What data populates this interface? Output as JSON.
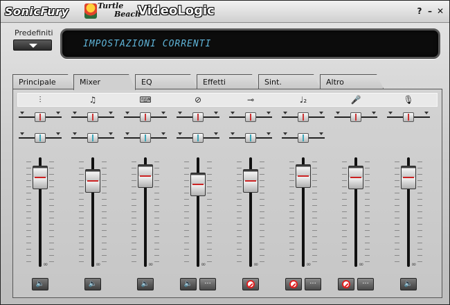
{
  "titlebar": {
    "brand_left": "SonicFury",
    "brand_turtle": "Turtle",
    "brand_beach": "Beach",
    "brand_product": "VideoLogic",
    "help_label": "?",
    "minimize_label": "–",
    "close_label": "✕"
  },
  "presets": {
    "label": "Predefiniti",
    "display_text": "IMPOSTAZIONI CORRENTI"
  },
  "tabs": [
    {
      "label": "Principale"
    },
    {
      "label": "Mixer"
    },
    {
      "label": "EQ"
    },
    {
      "label": "Effetti"
    },
    {
      "label": "Sint."
    },
    {
      "label": "Altro"
    }
  ],
  "active_tab": "Mixer",
  "channels": [
    {
      "icon": "master-icon",
      "glyph": "⫶",
      "pan_level": 0.5,
      "balance_level": 0.5,
      "fader_level": 0.82,
      "mute_state": "on",
      "has_options": false
    },
    {
      "icon": "music-note-icon",
      "glyph": "♫",
      "pan_level": 0.5,
      "balance_level": 0.5,
      "fader_level": 0.78,
      "mute_state": "on",
      "has_options": false
    },
    {
      "icon": "synth-icon",
      "glyph": "⌨",
      "pan_level": 0.5,
      "balance_level": 0.5,
      "fader_level": 0.84,
      "mute_state": "on",
      "has_options": false
    },
    {
      "icon": "cd-icon",
      "glyph": "⊘",
      "pan_level": 0.5,
      "balance_level": 0.5,
      "fader_level": 0.74,
      "mute_state": "on",
      "has_options": true
    },
    {
      "icon": "line-in-icon",
      "glyph": "⊸",
      "pan_level": 0.5,
      "balance_level": 0.5,
      "fader_level": 0.78,
      "mute_state": "off",
      "has_options": false
    },
    {
      "icon": "aux-note-icon",
      "glyph": "♩₂",
      "pan_level": 0.5,
      "balance_level": 0.5,
      "fader_level": 0.84,
      "mute_state": "off",
      "has_options": true
    },
    {
      "icon": "microphone-icon",
      "glyph": "🎤",
      "pan_level": 0.5,
      "balance_level": null,
      "fader_level": 0.82,
      "mute_state": "off",
      "has_options": true
    },
    {
      "icon": "phone-mic-icon",
      "glyph": "🎙",
      "pan_level": 0.5,
      "balance_level": null,
      "fader_level": 0.82,
      "mute_state": "on",
      "has_options": false
    }
  ],
  "infinity_label": "∞",
  "options_label": "···",
  "speaker_label": "🔈"
}
